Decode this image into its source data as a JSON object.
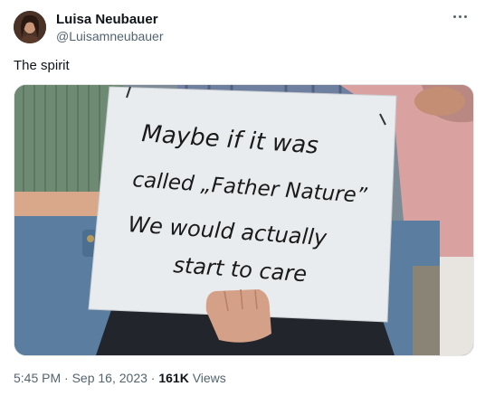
{
  "author": {
    "name": "Luisa Neubauer",
    "handle": "@Luisamneubauer",
    "avatar_icon": "profile-photo"
  },
  "tweet": {
    "text": "The spirit"
  },
  "media": {
    "sign_lines": [
      "Maybe if it was",
      "called „Father Nature”",
      "We would actually",
      "start to care"
    ]
  },
  "meta": {
    "time": "5:45 PM",
    "sep1": " · ",
    "date": "Sep 16, 2023",
    "sep2": " · ",
    "views_count": "161K",
    "views_label": " Views"
  }
}
